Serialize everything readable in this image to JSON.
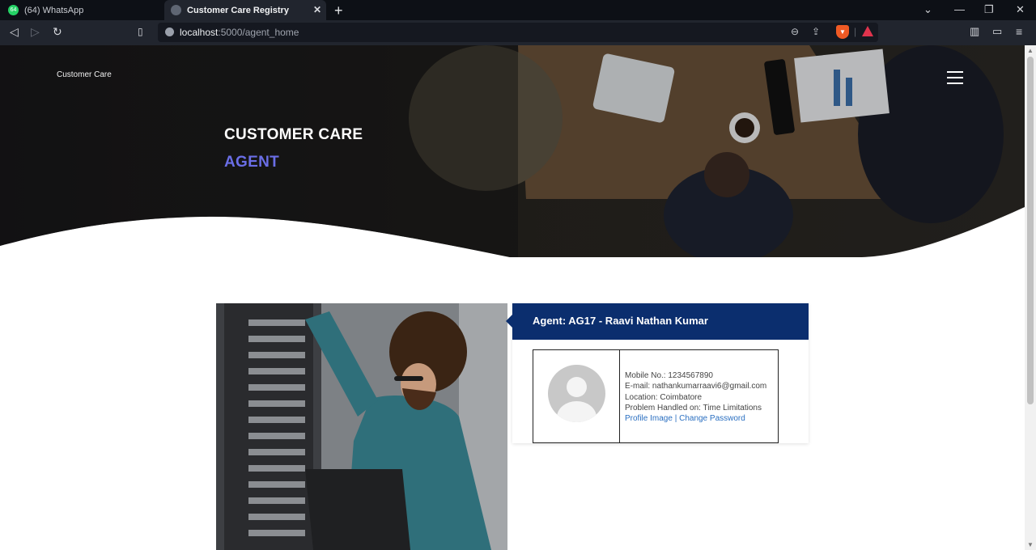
{
  "browser": {
    "tabs": [
      {
        "title": "(64) WhatsApp",
        "active": false,
        "badge": "64"
      },
      {
        "title": "Customer Care Registry",
        "active": true
      }
    ],
    "url_host": "localhost",
    "url_path": ":5000/agent_home"
  },
  "header": {
    "brand": "Customer Care",
    "title": "CUSTOMER CARE",
    "subtitle": "AGENT"
  },
  "agent": {
    "heading": "Agent: AG17 - Raavi Nathan Kumar",
    "mobile": "Mobile No.: 1234567890",
    "email": "E-mail: nathankumarraavi6@gmail.com",
    "location": "Location: Coimbatore",
    "problem": "Problem Handled on: Time Limitations",
    "profile_link": "Profile Image",
    "separator": "|",
    "password_link": "Change Password"
  },
  "colors": {
    "accent": "#6a6ee6",
    "card_header": "#0b2e6e",
    "link": "#2a6fc1"
  }
}
